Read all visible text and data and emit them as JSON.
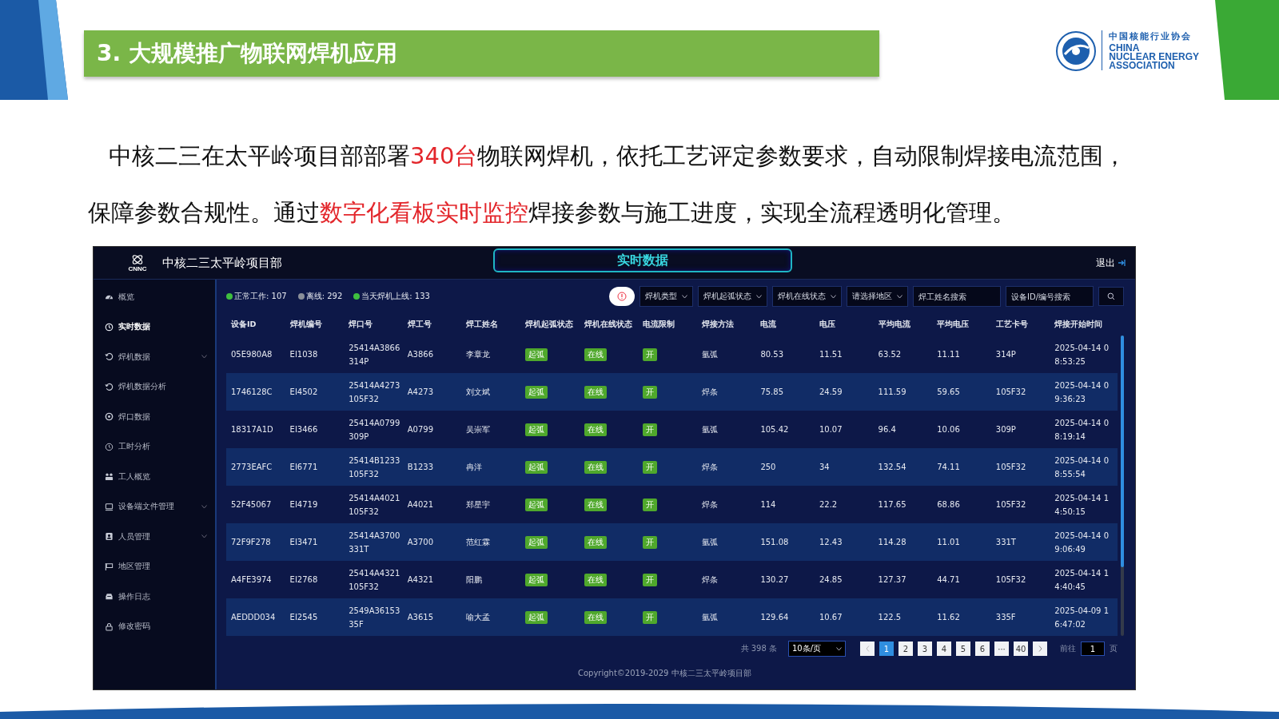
{
  "slide": {
    "title": "3. 大规模推广物联网焊机应用",
    "association": {
      "name_cn": "中国核能行业协会",
      "name_en": [
        "CHINA",
        "NUCLEAR ENERGY",
        "ASSOCIATION"
      ]
    },
    "paragraph": [
      {
        "text": "中核二三在太平岭项目部部署",
        "highlight": false
      },
      {
        "text": "340台",
        "highlight": true
      },
      {
        "text": "物联网焊机，依托工艺评定参数要求，自动限制焊接电流范围，保障参数合规性。通过",
        "highlight": false
      },
      {
        "text": "数字化看板实时监控",
        "highlight": true
      },
      {
        "text": "焊接参数与施工进度，实现全流程透明化管理。",
        "highlight": false
      }
    ]
  },
  "dashboard": {
    "logo_text": "CNNC",
    "brand": "中核二三太平岭项目部",
    "page_title": "实时数据",
    "logout": "退出",
    "sidebar": {
      "items": [
        {
          "label": "概览",
          "expandable": false,
          "selected": false
        },
        {
          "label": "实时数据",
          "expandable": false,
          "selected": true
        },
        {
          "label": "焊机数据",
          "expandable": true,
          "selected": false
        },
        {
          "label": "焊机数据分析",
          "expandable": false,
          "selected": false
        },
        {
          "label": "焊口数据",
          "expandable": false,
          "selected": false
        },
        {
          "label": "工时分析",
          "expandable": false,
          "selected": false
        },
        {
          "label": "工人概览",
          "expandable": false,
          "selected": false
        },
        {
          "label": "设备端文件管理",
          "expandable": true,
          "selected": false
        },
        {
          "label": "人员管理",
          "expandable": true,
          "selected": false
        },
        {
          "label": "地区管理",
          "expandable": false,
          "selected": false
        },
        {
          "label": "操作日志",
          "expandable": false,
          "selected": false
        },
        {
          "label": "修改密码",
          "expandable": false,
          "selected": false
        }
      ]
    },
    "status": [
      {
        "label": "正常工作: 107",
        "color": "#3fbf3f"
      },
      {
        "label": "离线: 292",
        "color": "#8a8f99"
      },
      {
        "label": "当天焊机上线: 133",
        "color": "#3fbf3f"
      }
    ],
    "filters": [
      {
        "kind": "select",
        "placeholder": "焊机类型"
      },
      {
        "kind": "select",
        "placeholder": "焊机起弧状态"
      },
      {
        "kind": "select",
        "placeholder": "焊机在线状态"
      },
      {
        "kind": "select",
        "placeholder": "请选择地区"
      },
      {
        "kind": "search",
        "placeholder": "焊工姓名搜索"
      },
      {
        "kind": "search",
        "placeholder": "设备ID/编号搜索"
      }
    ],
    "table": {
      "columns": [
        {
          "label": "设备ID",
          "kind": "text"
        },
        {
          "label": "焊机编号",
          "kind": "text"
        },
        {
          "label": "焊口号",
          "kind": "text"
        },
        {
          "label": "焊工号",
          "kind": "text"
        },
        {
          "label": "焊工姓名",
          "kind": "text"
        },
        {
          "label": "焊机起弧状态",
          "kind": "badge"
        },
        {
          "label": "焊机在线状态",
          "kind": "badge"
        },
        {
          "label": "电流限制",
          "kind": "badge"
        },
        {
          "label": "焊接方法",
          "kind": "text"
        },
        {
          "label": "电流",
          "kind": "text"
        },
        {
          "label": "电压",
          "kind": "text"
        },
        {
          "label": "平均电流",
          "kind": "text"
        },
        {
          "label": "平均电压",
          "kind": "text"
        },
        {
          "label": "工艺卡号",
          "kind": "text"
        },
        {
          "label": "焊接开始时间",
          "kind": "text"
        }
      ],
      "rows": [
        [
          "05E980A8",
          "EI1038",
          "25414A3866314P",
          "A3866",
          "李章龙",
          "起弧",
          "在线",
          "开",
          "氩弧",
          "80.53",
          "11.51",
          "63.52",
          "11.11",
          "314P",
          "2025-04-14 08:53:25"
        ],
        [
          "1746128C",
          "EI4502",
          "25414A4273105F32",
          "A4273",
          "刘文斌",
          "起弧",
          "在线",
          "开",
          "焊条",
          "75.85",
          "24.59",
          "111.59",
          "59.65",
          "105F32",
          "2025-04-14 09:36:23"
        ],
        [
          "18317A1D",
          "EI3466",
          "25414A0799309P",
          "A0799",
          "吴崇军",
          "起弧",
          "在线",
          "开",
          "氩弧",
          "105.42",
          "10.07",
          "96.4",
          "10.06",
          "309P",
          "2025-04-14 08:19:14"
        ],
        [
          "2773EAFC",
          "EI6771",
          "25414B1233105F32",
          "B1233",
          "冉洋",
          "起弧",
          "在线",
          "开",
          "焊条",
          "250",
          "34",
          "132.54",
          "74.11",
          "105F32",
          "2025-04-14 08:55:54"
        ],
        [
          "52F45067",
          "EI4719",
          "25414A4021105F32",
          "A4021",
          "郑星宇",
          "起弧",
          "在线",
          "开",
          "焊条",
          "114",
          "22.2",
          "117.65",
          "68.86",
          "105F32",
          "2025-04-14 14:50:15"
        ],
        [
          "72F9F278",
          "EI3471",
          "25414A3700331T",
          "A3700",
          "范红霖",
          "起弧",
          "在线",
          "开",
          "氩弧",
          "151.08",
          "12.43",
          "114.28",
          "11.01",
          "331T",
          "2025-04-14 09:06:49"
        ],
        [
          "A4FE3974",
          "EI2768",
          "25414A4321105F32",
          "A4321",
          "阳鹏",
          "起弧",
          "在线",
          "开",
          "焊条",
          "130.27",
          "24.85",
          "127.37",
          "44.71",
          "105F32",
          "2025-04-14 14:40:45"
        ],
        [
          "AEDDD034",
          "EI2545",
          "2549A3615335F",
          "A3615",
          "喻大孟",
          "起弧",
          "在线",
          "开",
          "氩弧",
          "129.64",
          "10.67",
          "122.5",
          "11.62",
          "335F",
          "2025-04-09 16:47:02"
        ]
      ]
    },
    "pagination": {
      "total": "共 398 条",
      "page_size": "10条/页",
      "pages": [
        {
          "label": "1",
          "selected": true
        },
        {
          "label": "2",
          "selected": false
        },
        {
          "label": "3",
          "selected": false
        },
        {
          "label": "4",
          "selected": false
        },
        {
          "label": "5",
          "selected": false
        },
        {
          "label": "6",
          "selected": false
        },
        {
          "label": "···",
          "selected": false
        },
        {
          "label": "40",
          "selected": false
        }
      ],
      "goto_label": "前往",
      "goto_value": "1",
      "goto_unit": "页"
    },
    "footer": "Copyright©2019-2029 中核二三太平岭项目部"
  }
}
